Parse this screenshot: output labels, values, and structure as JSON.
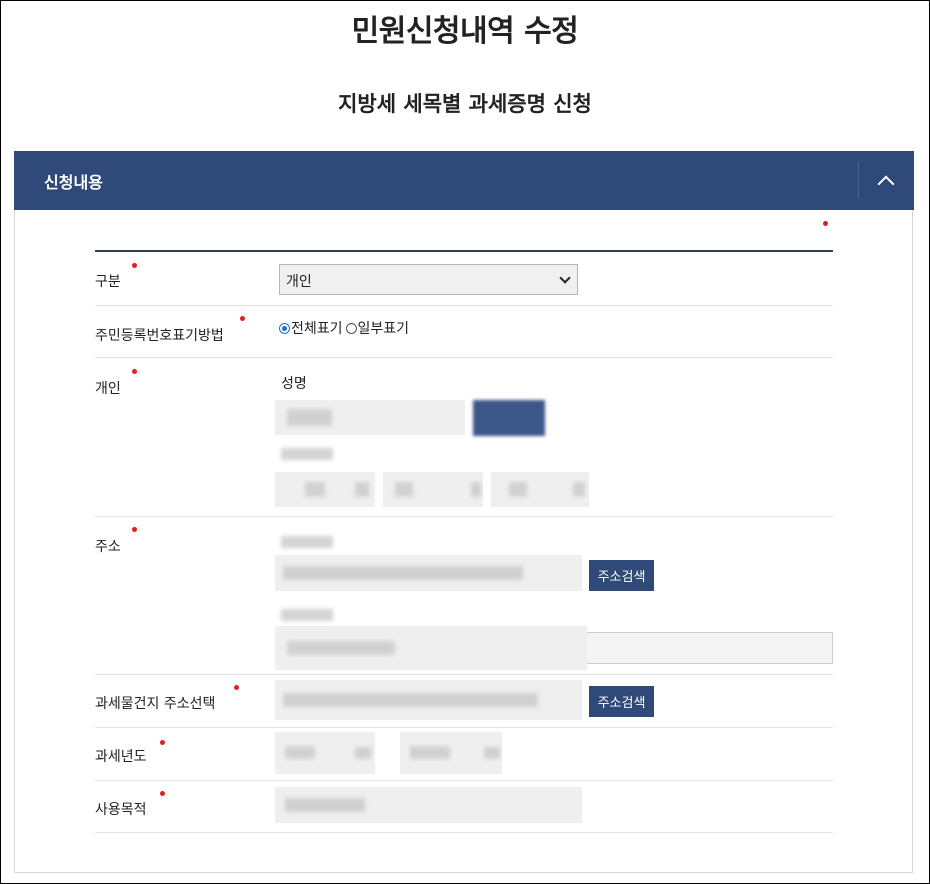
{
  "page": {
    "title": "민원신청내역 수정",
    "subtitle": "지방세 세목별 과세증명 신청"
  },
  "panel": {
    "header_label": "신청내용",
    "toggle_icon": "chevron-up-icon"
  },
  "form": {
    "category": {
      "label": "구분",
      "selected": "개인"
    },
    "rrn_display": {
      "label": "주민등록번호표기방법",
      "options": [
        {
          "label": "전체표기",
          "selected": true
        },
        {
          "label": "일부표기",
          "selected": false
        }
      ]
    },
    "individual": {
      "label": "개인",
      "name_label": "성명"
    },
    "address": {
      "label": "주소",
      "search_button": "주소검색"
    },
    "taxable_address": {
      "label": "과세물건지 주소선택",
      "search_button": "주소검색"
    },
    "tax_year": {
      "label": "과세년도"
    },
    "purpose": {
      "label": "사용목적"
    }
  },
  "colors": {
    "header_bg": "#2f4a78",
    "required_dot": "#e02020"
  }
}
